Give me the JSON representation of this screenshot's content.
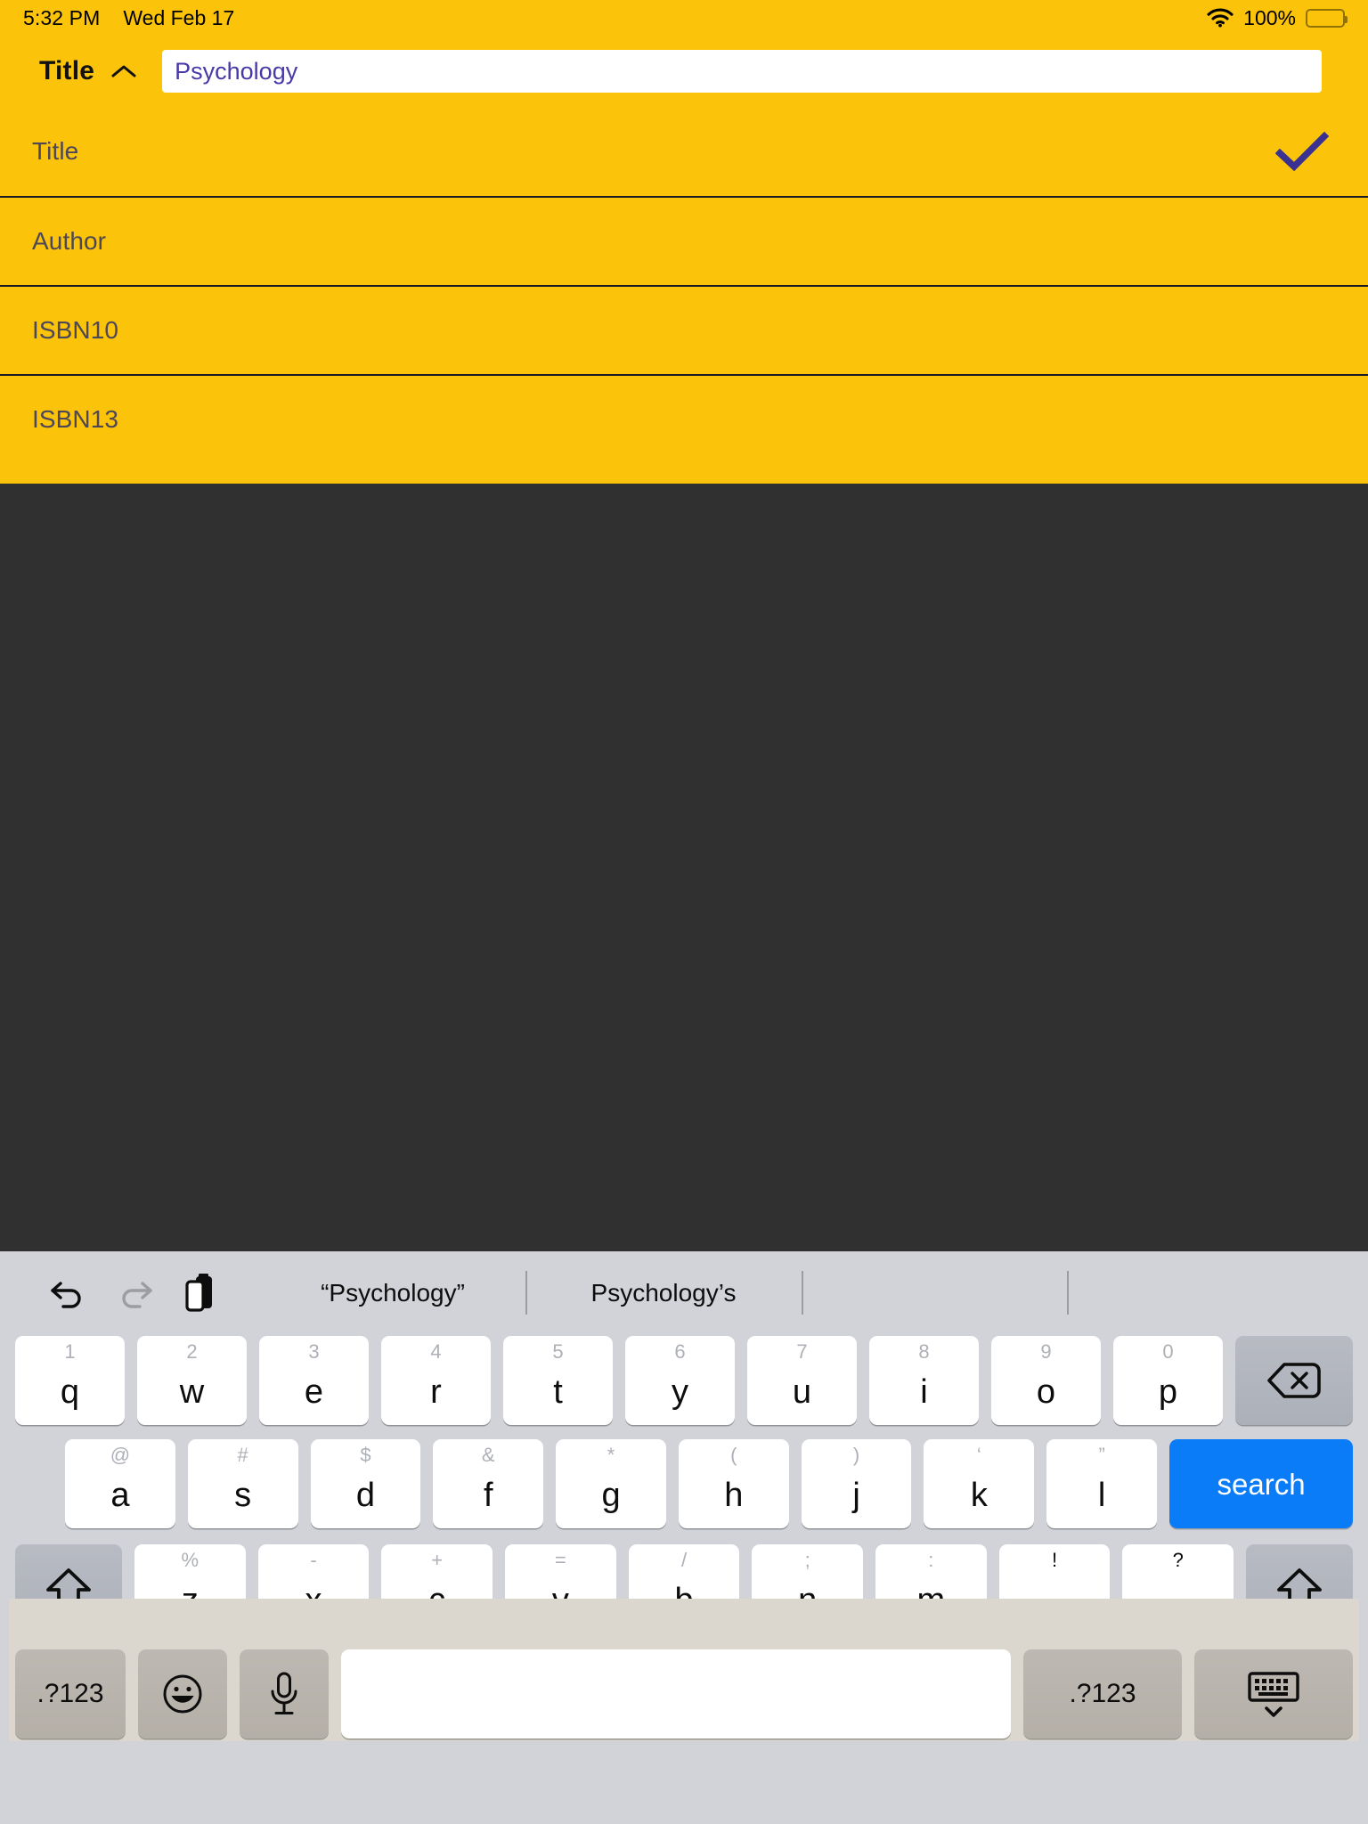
{
  "status_bar": {
    "time": "5:32 PM",
    "date": "Wed Feb 17",
    "battery_percent": "100%",
    "wifi_icon": "wifi-icon",
    "battery_icon": "battery-full-icon"
  },
  "form": {
    "accent_color": "#FBC40A",
    "active_field": {
      "label": "Title",
      "collapse_icon": "chevron-up-icon",
      "input_value": "Psychology",
      "input_placeholder": "",
      "input_text_color": "#4739A8"
    },
    "rows": [
      {
        "label": "Title",
        "checked": true,
        "check_icon": "checkmark-icon",
        "check_color": "#3B3191"
      },
      {
        "label": "Author",
        "checked": false,
        "check_icon": "",
        "check_color": ""
      },
      {
        "label": "ISBN10",
        "checked": false,
        "check_icon": "",
        "check_color": ""
      },
      {
        "label": "ISBN13",
        "checked": false,
        "check_icon": "",
        "check_color": ""
      }
    ]
  },
  "keyboard": {
    "background_color": "#D1D3D9",
    "toolbar": [
      {
        "name": "undo-icon",
        "enabled": true
      },
      {
        "name": "redo-icon",
        "enabled": false
      },
      {
        "name": "paste-icon",
        "enabled": true
      }
    ],
    "suggestions": [
      "“Psychology”",
      "Psychology’s",
      ""
    ],
    "row1": [
      {
        "hint": "1",
        "main": "q"
      },
      {
        "hint": "2",
        "main": "w"
      },
      {
        "hint": "3",
        "main": "e"
      },
      {
        "hint": "4",
        "main": "r"
      },
      {
        "hint": "5",
        "main": "t"
      },
      {
        "hint": "6",
        "main": "y"
      },
      {
        "hint": "7",
        "main": "u"
      },
      {
        "hint": "8",
        "main": "i"
      },
      {
        "hint": "9",
        "main": "o"
      },
      {
        "hint": "0",
        "main": "p"
      }
    ],
    "backspace_icon": "backspace-icon",
    "row2": [
      {
        "hint": "@",
        "main": "a"
      },
      {
        "hint": "#",
        "main": "s"
      },
      {
        "hint": "$",
        "main": "d"
      },
      {
        "hint": "&",
        "main": "f"
      },
      {
        "hint": "*",
        "main": "g"
      },
      {
        "hint": "(",
        "main": "h"
      },
      {
        "hint": ")",
        "main": "j"
      },
      {
        "hint": "‘",
        "main": "k"
      },
      {
        "hint": "”",
        "main": "l"
      }
    ],
    "search_label": "search",
    "row3": [
      {
        "hint": "%",
        "main": "z",
        "hint_dark": false
      },
      {
        "hint": "-",
        "main": "x",
        "hint_dark": false
      },
      {
        "hint": "+",
        "main": "c",
        "hint_dark": false
      },
      {
        "hint": "=",
        "main": "v",
        "hint_dark": false
      },
      {
        "hint": "/",
        "main": "b",
        "hint_dark": false
      },
      {
        "hint": ";",
        "main": "n",
        "hint_dark": false
      },
      {
        "hint": ":",
        "main": "m",
        "hint_dark": false
      },
      {
        "hint": "!",
        "main": ",",
        "hint_dark": true
      },
      {
        "hint": "?",
        "main": ".",
        "hint_dark": true
      }
    ],
    "shift_left_icon": "shift-icon",
    "shift_right_icon": "shift-icon",
    "row4": {
      "numbers_left_label": ".?123",
      "emoji_icon": "emoji-smiley-icon",
      "mic_icon": "microphone-icon",
      "space_label": "",
      "numbers_right_label": ".?123",
      "dismiss_icon": "dismiss-keyboard-icon"
    }
  }
}
